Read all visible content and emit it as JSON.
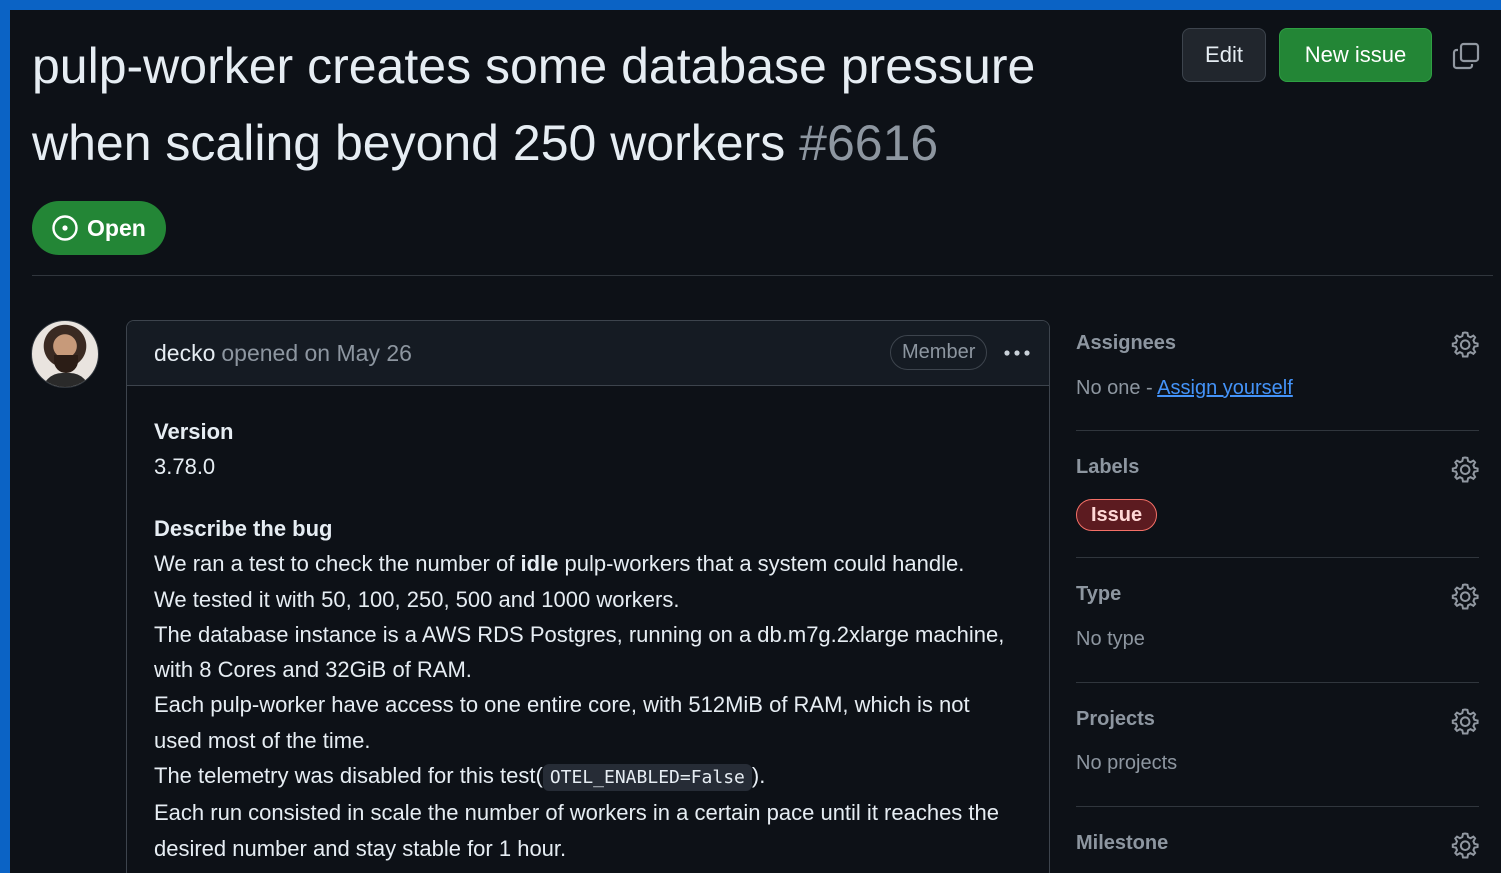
{
  "issue": {
    "title": "pulp-worker creates some database pressure when scaling beyond 250 workers",
    "number": "#6616",
    "state": "Open"
  },
  "header": {
    "edit_label": "Edit",
    "new_issue_label": "New issue"
  },
  "comment": {
    "author": "decko",
    "meta": "opened on May 26",
    "badge": "Member",
    "version_heading": "Version",
    "version_value": "3.78.0",
    "bug_heading": "Describe the bug",
    "line1_pre": "We ran a test to check the number of ",
    "line1_bold": "idle",
    "line1_post": " pulp-workers that a system could handle.",
    "line2": "We tested it with 50, 100, 250, 500 and 1000 workers.",
    "line3": "The database instance is a AWS RDS Postgres, running on a db.m7g.2xlarge machine, with 8 Cores and 32GiB of RAM.",
    "line4": "Each pulp-worker have access to one entire core, with 512MiB of RAM, which is not used most of the time.",
    "line5_pre": "The telemetry was disabled for this test(",
    "line5_code": "OTEL_ENABLED=False",
    "line5_post": ").",
    "line6": "Each run consisted in scale the number of workers in a certain pace until it reaches the desired number and stay stable for 1 hour."
  },
  "sidebar": {
    "assignees": {
      "title": "Assignees",
      "value": "No one - ",
      "link": "Assign yourself"
    },
    "labels": {
      "title": "Labels",
      "items": [
        "Issue"
      ]
    },
    "type": {
      "title": "Type",
      "value": "No type"
    },
    "projects": {
      "title": "Projects",
      "value": "No projects"
    },
    "milestone": {
      "title": "Milestone"
    }
  },
  "colors": {
    "open_green": "#238636",
    "link_blue": "#4493f8",
    "label_border": "#f47067",
    "background": "#0d1117"
  },
  "icons": [
    "issue-opened-icon",
    "copy-icon",
    "kebab-icon",
    "gear-icon"
  ]
}
